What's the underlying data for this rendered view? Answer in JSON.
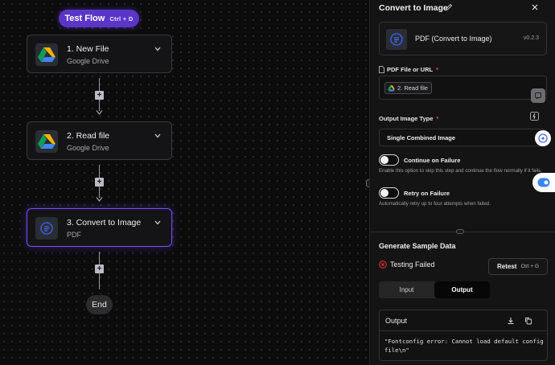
{
  "canvas": {
    "test_flow_label": "Test Flow",
    "test_flow_shortcut": "Ctrl + D",
    "steps": [
      {
        "title": "1. New File",
        "subtitle": "Google Drive",
        "icon": "google-drive-icon"
      },
      {
        "title": "2. Read file",
        "subtitle": "Google Drive",
        "icon": "google-drive-icon"
      },
      {
        "title": "3. Convert to Image",
        "subtitle": "PDF",
        "icon": "pdf-piece-icon"
      }
    ],
    "end_label": "End",
    "colors": {
      "accent": "#5b35c9",
      "active_border": "#7c4dff"
    }
  },
  "panel": {
    "title": "Convert to Image",
    "piece": {
      "name": "PDF (Convert to Image)",
      "version": "v0.2.3"
    },
    "pdf_field": {
      "label": "PDF File or URL",
      "chip": "2. Read file"
    },
    "output_type": {
      "label": "Output Image Type",
      "value": "Single Combined Image"
    },
    "continue_on_failure": {
      "title": "Continue on Failure",
      "description": "Enable this option to skip this step and continue the flow normally if it fails."
    },
    "retry_on_failure": {
      "title": "Retry on Failure",
      "description": "Automatically retry up to four attempts when failed."
    },
    "sample_data": {
      "title": "Generate Sample Data",
      "status": "Testing Failed",
      "retest_label": "Retest",
      "retest_shortcut": "Ctrl + G",
      "tabs": [
        "Input",
        "Output"
      ],
      "active_tab": "Output",
      "output_title": "Output",
      "output_text": "\"Fontconfig error: Cannot load default config file\\n\""
    }
  }
}
